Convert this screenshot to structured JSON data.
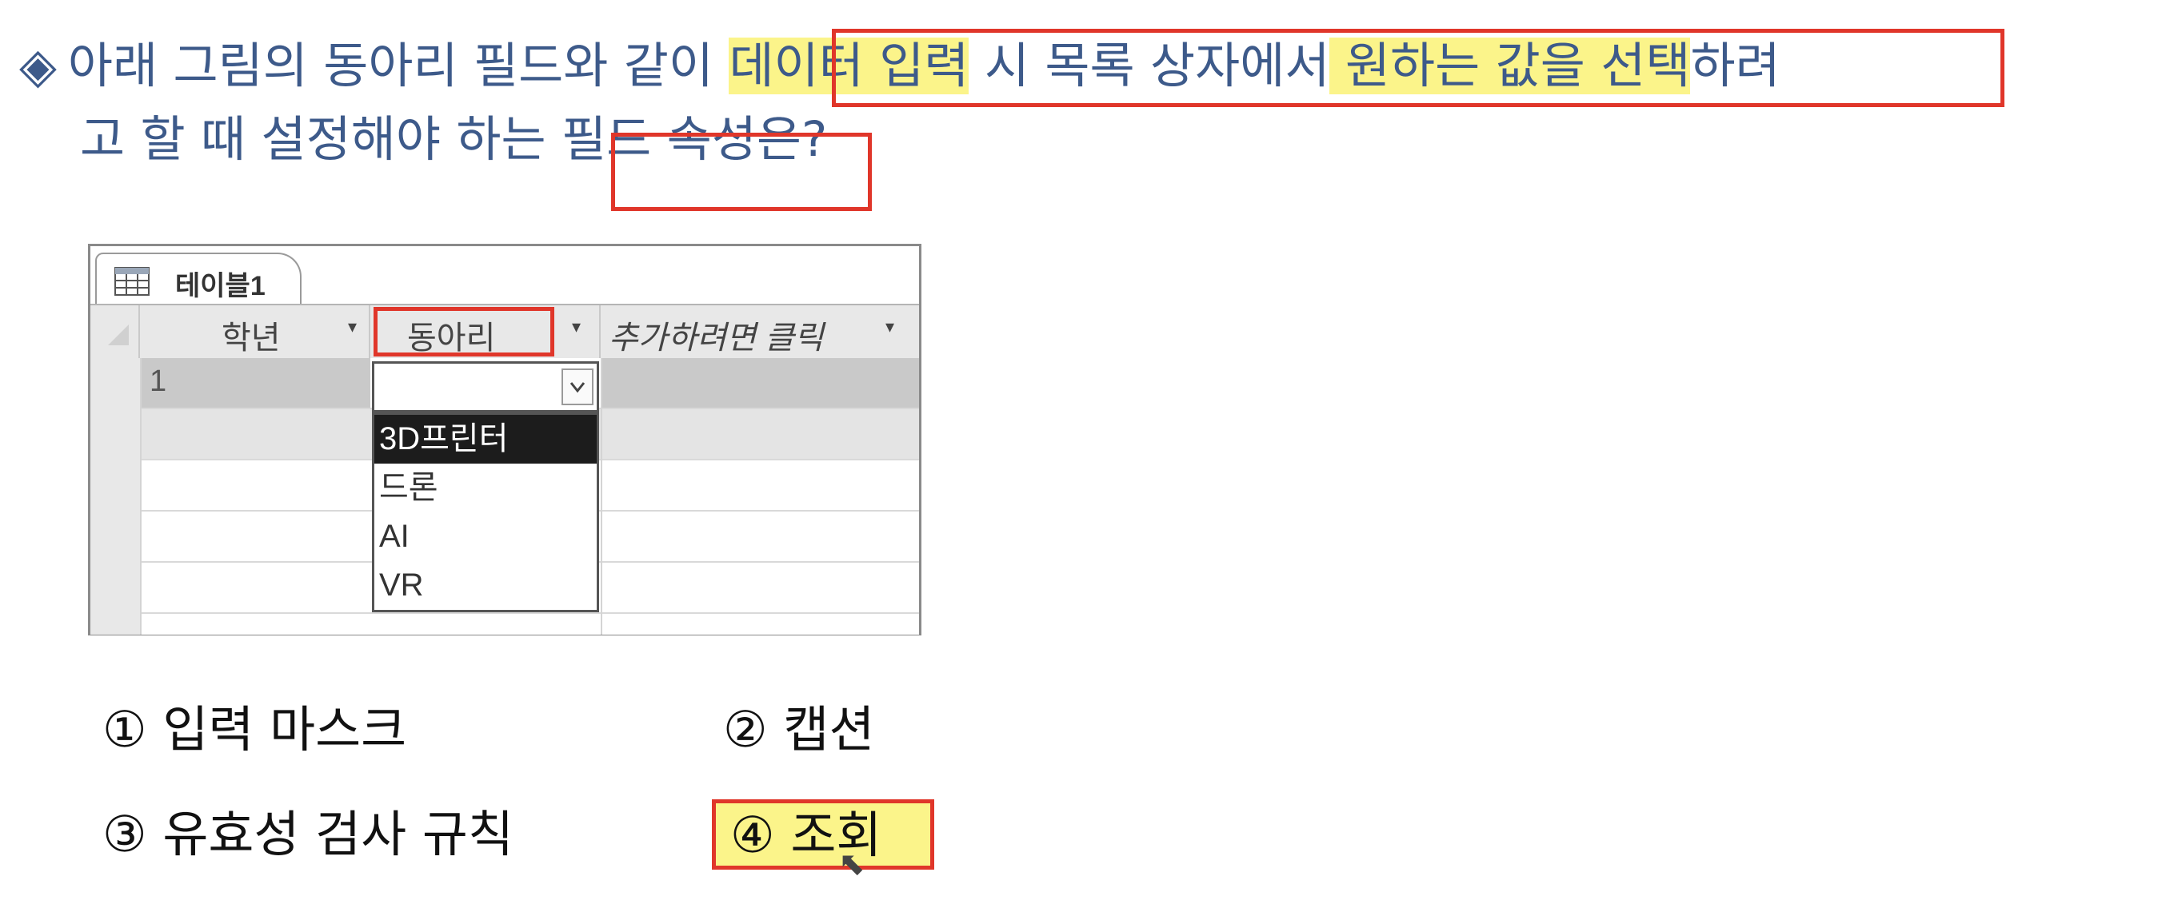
{
  "question": {
    "bullet": "◈",
    "line1_a": "아래 그림의 동아리 필드와 같이 ",
    "line1_hl1": "데이터 입력",
    "line1_b": " 시 목록 상자에서",
    "line1_hl2": " 원하는 값을 선택",
    "line1_c": "하려",
    "line2_a": "고 할 때 설정해야 하는 ",
    "line2_box": "필드 속성",
    "line2_b": "은?"
  },
  "table": {
    "tab_label": "테이블1",
    "columns": [
      "학년",
      "동아리",
      "추가하려면 클릭"
    ],
    "rows": [
      {
        "학년": "1",
        "동아리": ""
      }
    ],
    "new_row_marker": "✶",
    "dropdown_options": [
      "3D프린터",
      "드론",
      "AI",
      "VR"
    ],
    "dropdown_highlighted": "3D프린터"
  },
  "choices": [
    {
      "mark": "①",
      "text": "입력 마스크"
    },
    {
      "mark": "②",
      "text": "캡션"
    },
    {
      "mark": "③",
      "text": "유효성 검사 규칙"
    },
    {
      "mark": "④",
      "text": "조회"
    }
  ],
  "colors": {
    "question_text": "#3d5a8a",
    "highlight": "#fbf48a",
    "annotation_box": "#e0362a",
    "answer_highlight": "#fbf48a"
  }
}
